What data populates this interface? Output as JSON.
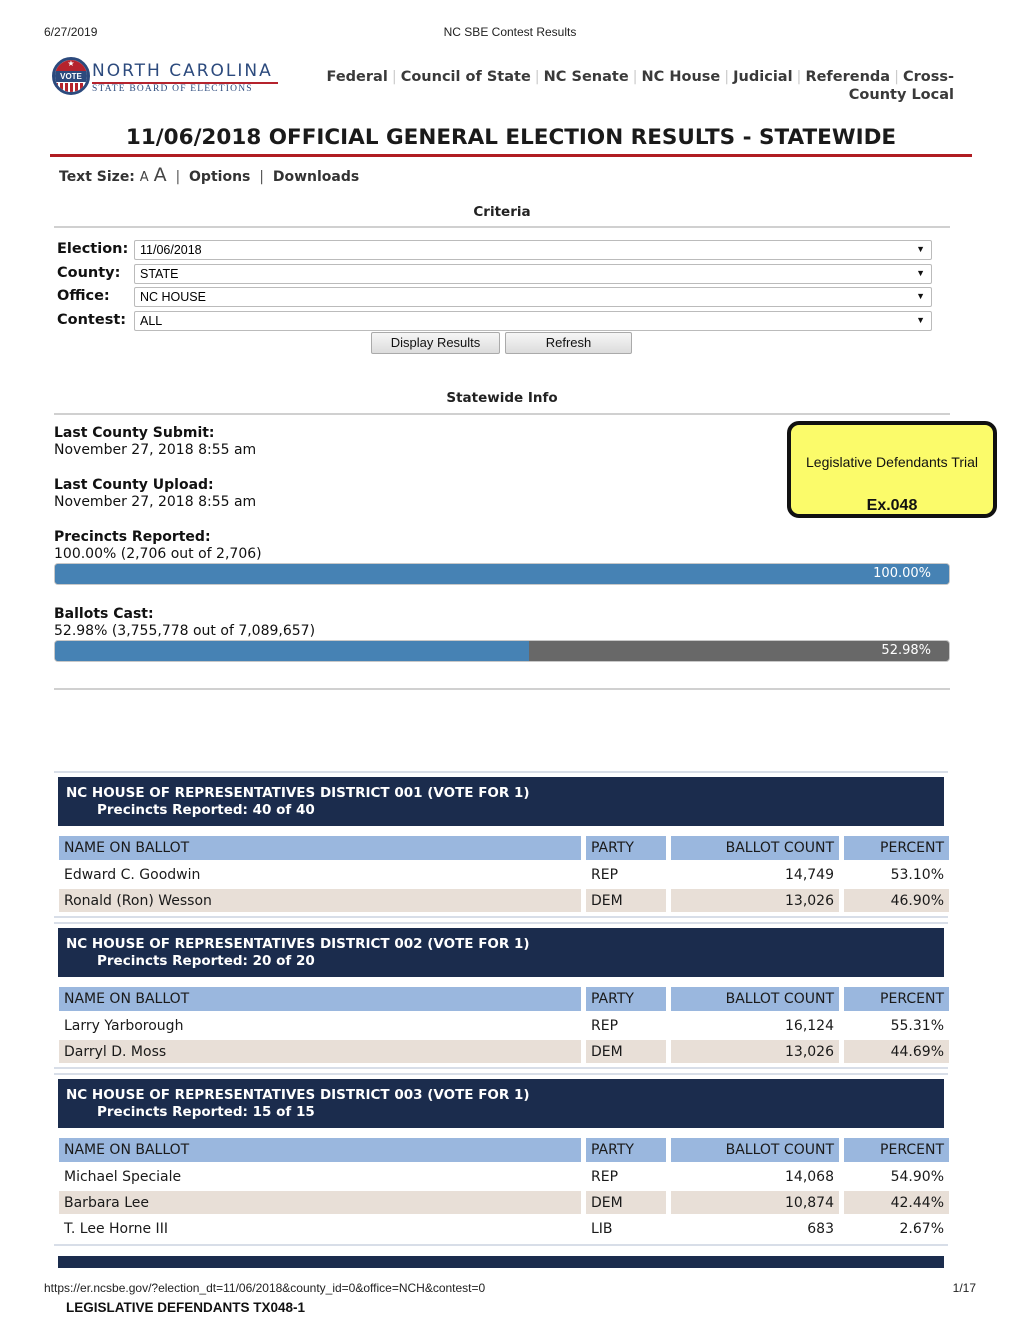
{
  "print_header": {
    "date": "6/27/2019",
    "title": "NC SBE Contest Results"
  },
  "logo": {
    "seal_text": "VOTE",
    "name": "NORTH CAROLINA",
    "subtitle": "STATE BOARD OF ELECTIONS"
  },
  "nav": {
    "items": [
      {
        "label": "Federal"
      },
      {
        "label": "Council of State"
      },
      {
        "label": "NC Senate"
      },
      {
        "label": "NC House"
      },
      {
        "label": "Judicial"
      },
      {
        "label": "Referenda"
      },
      {
        "label": "Cross-County Local"
      }
    ],
    "separator": "|"
  },
  "page_title": "11/06/2018 OFFICIAL GENERAL ELECTION RESULTS - STATEWIDE",
  "toolbar": {
    "text_size_label": "Text Size:",
    "text_size_small": "A",
    "text_size_large": "A",
    "separator": "|",
    "options_label": "Options",
    "downloads_label": "Downloads"
  },
  "criteria": {
    "heading": "Criteria",
    "fields": [
      {
        "label": "Election:",
        "value": "11/06/2018"
      },
      {
        "label": "County:",
        "value": "STATE"
      },
      {
        "label": "Office:",
        "value": "NC HOUSE"
      },
      {
        "label": "Contest:",
        "value": "ALL"
      }
    ],
    "arrow_glyph": "▼",
    "display_button": "Display Results",
    "refresh_button": "Refresh"
  },
  "statewide_info": {
    "heading": "Statewide Info",
    "last_submit_label": "Last County Submit:",
    "last_submit_value": "November 27, 2018 8:55 am",
    "last_upload_label": "Last County Upload:",
    "last_upload_value": "November 27, 2018 8:55 am",
    "precincts_label": "Precincts Reported:",
    "precincts_value": "100.00% (2,706 out of 2,706)",
    "precincts_percent": 100.0,
    "precincts_bar_text": "100.00%",
    "ballots_label": "Ballots Cast:",
    "ballots_value": "52.98% (3,755,778 out of 7,089,657)",
    "ballots_percent": 52.98,
    "ballots_bar_text": "52.98%"
  },
  "exhibit_sticker": {
    "line1": "Legislative Defendants Trial",
    "line2": "Ex.048",
    "color": "#fbfb6a"
  },
  "colors": {
    "contest_header": "#1b2c4d",
    "table_header": "#9ab7de",
    "alt_row": "#e8dfd7",
    "progress_fill": "#4682b4",
    "progress_track": "#686868",
    "title_rule": "#b01c22"
  },
  "table_columns": [
    "NAME ON BALLOT",
    "PARTY",
    "BALLOT COUNT",
    "PERCENT"
  ],
  "contests": [
    {
      "title": "NC HOUSE OF REPRESENTATIVES DISTRICT 001 (VOTE FOR 1)",
      "precincts": "Precincts Reported: 40 of 40",
      "rows": [
        {
          "name": "Edward C. Goodwin",
          "party": "REP",
          "count": "14,749",
          "percent": "53.10%"
        },
        {
          "name": "Ronald (Ron) Wesson",
          "party": "DEM",
          "count": "13,026",
          "percent": "46.90%"
        }
      ]
    },
    {
      "title": "NC HOUSE OF REPRESENTATIVES DISTRICT 002 (VOTE FOR 1)",
      "precincts": "Precincts Reported: 20 of 20",
      "rows": [
        {
          "name": "Larry Yarborough",
          "party": "REP",
          "count": "16,124",
          "percent": "55.31%"
        },
        {
          "name": "Darryl D. Moss",
          "party": "DEM",
          "count": "13,026",
          "percent": "44.69%"
        }
      ]
    },
    {
      "title": "NC HOUSE OF REPRESENTATIVES DISTRICT 003 (VOTE FOR 1)",
      "precincts": "Precincts Reported: 15 of 15",
      "rows": [
        {
          "name": "Michael Speciale",
          "party": "REP",
          "count": "14,068",
          "percent": "54.90%"
        },
        {
          "name": "Barbara Lee",
          "party": "DEM",
          "count": "10,874",
          "percent": "42.44%"
        },
        {
          "name": "T. Lee Horne III",
          "party": "LIB",
          "count": "683",
          "percent": "2.67%"
        }
      ]
    }
  ],
  "print_footer": {
    "url": "https://er.ncsbe.gov/?election_dt=11/06/2018&county_id=0&office=NCH&contest=0",
    "page": "1/17"
  },
  "exhibit_footer": "LEGISLATIVE DEFENDANTS TX048-1"
}
